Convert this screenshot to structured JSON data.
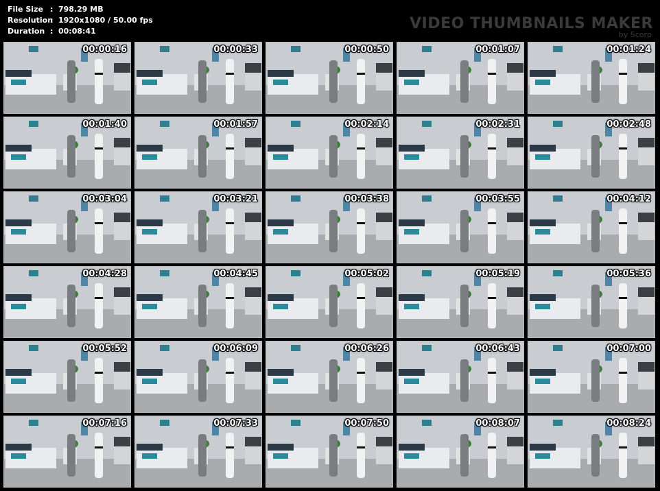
{
  "info": [
    {
      "label": "File Size",
      "value": "798.29 MB"
    },
    {
      "label": "Resolution",
      "value": "1920x1080 / 50.00 fps"
    },
    {
      "label": "Duration",
      "value": "00:08:41"
    }
  ],
  "watermark": {
    "title": "VIDEO THUMBNAILS MAKER",
    "subtitle": "by Scorp"
  },
  "separator": ":",
  "thumbnails": [
    "00:00:16",
    "00:00:33",
    "00:00:50",
    "00:01:07",
    "00:01:24",
    "00:01:40",
    "00:01:57",
    "00:02:14",
    "00:02:31",
    "00:02:48",
    "00:03:04",
    "00:03:21",
    "00:03:38",
    "00:03:55",
    "00:04:12",
    "00:04:28",
    "00:04:45",
    "00:05:02",
    "00:05:19",
    "00:05:36",
    "00:05:52",
    "00:06:09",
    "00:06:26",
    "00:06:43",
    "00:07:00",
    "00:07:16",
    "00:07:33",
    "00:07:50",
    "00:08:07",
    "00:08:24"
  ],
  "colors": {
    "background": "#000000",
    "info_text": "#ffffff",
    "watermark": "#3a3a3a",
    "thumb_border": "#bbbbbb"
  }
}
